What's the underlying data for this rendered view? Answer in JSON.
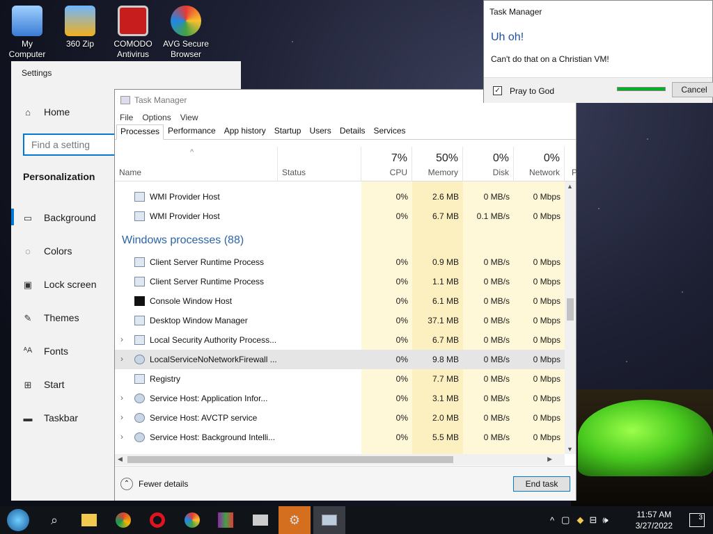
{
  "desktop": {
    "icons": [
      {
        "label_1": "My",
        "label_2": "Computer",
        "name": "computer-icon"
      },
      {
        "label_1": "360 Zip",
        "label_2": "",
        "name": "360zip-icon"
      },
      {
        "label_1": "COMODO",
        "label_2": "Antivirus",
        "name": "comodo-icon"
      },
      {
        "label_1": "AVG Secure",
        "label_2": "Browser",
        "name": "avg-browser-icon"
      }
    ]
  },
  "settings": {
    "title": "Settings",
    "home": "Home",
    "search_placeholder": "Find a setting",
    "section": "Personalization",
    "items": [
      "Background",
      "Colors",
      "Lock screen",
      "Themes",
      "Fonts",
      "Start",
      "Taskbar"
    ]
  },
  "taskmanager": {
    "title": "Task Manager",
    "menu": [
      "File",
      "Options",
      "View"
    ],
    "tabs": [
      "Processes",
      "Performance",
      "App history",
      "Startup",
      "Users",
      "Details",
      "Services"
    ],
    "columns": {
      "name": "Name",
      "status": "Status",
      "cpu_pct": "7%",
      "cpu": "CPU",
      "mem_pct": "50%",
      "mem": "Memory",
      "disk_pct": "0%",
      "disk": "Disk",
      "net_pct": "0%",
      "net": "Network",
      "power": "P"
    },
    "rows_top": [
      {
        "name": "WMI Provider Host",
        "cpu": "0%",
        "mem": "2.6 MB",
        "disk": "0 MB/s",
        "net": "0 Mbps"
      },
      {
        "name": "WMI Provider Host",
        "cpu": "0%",
        "mem": "6.7 MB",
        "disk": "0.1 MB/s",
        "net": "0 Mbps"
      }
    ],
    "group": "Windows processes (88)",
    "rows": [
      {
        "name": "Client Server Runtime Process",
        "cpu": "0%",
        "mem": "0.9 MB",
        "disk": "0 MB/s",
        "net": "0 Mbps",
        "expand": false,
        "icon": "window"
      },
      {
        "name": "Client Server Runtime Process",
        "cpu": "0%",
        "mem": "1.1 MB",
        "disk": "0 MB/s",
        "net": "0 Mbps",
        "expand": false,
        "icon": "window"
      },
      {
        "name": "Console Window Host",
        "cpu": "0%",
        "mem": "6.1 MB",
        "disk": "0 MB/s",
        "net": "0 Mbps",
        "expand": false,
        "icon": "console"
      },
      {
        "name": "Desktop Window Manager",
        "cpu": "0%",
        "mem": "37.1 MB",
        "disk": "0 MB/s",
        "net": "0 Mbps",
        "expand": false,
        "icon": "window"
      },
      {
        "name": "Local Security Authority Process...",
        "cpu": "0%",
        "mem": "6.7 MB",
        "disk": "0 MB/s",
        "net": "0 Mbps",
        "expand": true,
        "icon": "window"
      },
      {
        "name": "LocalServiceNoNetworkFirewall ...",
        "cpu": "0%",
        "mem": "9.8 MB",
        "disk": "0 MB/s",
        "net": "0 Mbps",
        "expand": true,
        "icon": "gear",
        "selected": true
      },
      {
        "name": "Registry",
        "cpu": "0%",
        "mem": "7.7 MB",
        "disk": "0 MB/s",
        "net": "0 Mbps",
        "expand": false,
        "icon": "window"
      },
      {
        "name": "Service Host: Application Infor...",
        "cpu": "0%",
        "mem": "3.1 MB",
        "disk": "0 MB/s",
        "net": "0 Mbps",
        "expand": true,
        "icon": "gear"
      },
      {
        "name": "Service Host: AVCTP service",
        "cpu": "0%",
        "mem": "2.0 MB",
        "disk": "0 MB/s",
        "net": "0 Mbps",
        "expand": true,
        "icon": "gear"
      },
      {
        "name": "Service Host: Background Intelli...",
        "cpu": "0%",
        "mem": "5.5 MB",
        "disk": "0 MB/s",
        "net": "0 Mbps",
        "expand": true,
        "icon": "gear"
      }
    ],
    "fewer_details": "Fewer details",
    "end_task": "End task"
  },
  "dialog": {
    "title": "Task Manager",
    "heading": "Uh oh!",
    "message": "Can't do that on a Christian VM!",
    "checkbox_label": "Pray to God",
    "checked": true,
    "cancel": "Cancel",
    "progress": 1.0
  },
  "taskbar": {
    "time": "11:57 AM",
    "date": "3/27/2022",
    "notifications": "3",
    "accent": "#d36f1f"
  }
}
